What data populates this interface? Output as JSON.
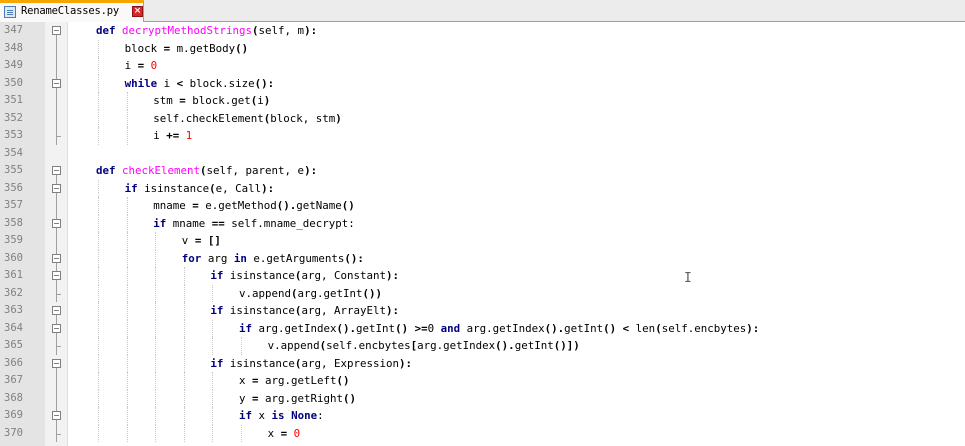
{
  "tab": {
    "title": "RenameClasses.py",
    "icon": "python-file-icon",
    "close_icon": "close-icon"
  },
  "colors": {
    "keyword": "#00007f",
    "function_name": "#ff00ff",
    "number": "#ff0000",
    "tab_accent": "#f7a500"
  },
  "lines": [
    {
      "num": "347",
      "fold": "box",
      "indent": 0,
      "tokens": [
        [
          "kw",
          "def "
        ],
        [
          "fn",
          "decryptMethodStrings"
        ],
        [
          "op",
          "("
        ],
        [
          "t",
          "self, m"
        ],
        [
          "op",
          "):"
        ]
      ]
    },
    {
      "num": "348",
      "fold": "line",
      "indent": 1,
      "tokens": [
        [
          "t",
          "block "
        ],
        [
          "op",
          "="
        ],
        [
          "t",
          " m.getBody"
        ],
        [
          "op",
          "()"
        ]
      ]
    },
    {
      "num": "349",
      "fold": "line",
      "indent": 1,
      "tokens": [
        [
          "t",
          "i "
        ],
        [
          "op",
          "="
        ],
        [
          "t",
          " "
        ],
        [
          "num",
          "0"
        ]
      ]
    },
    {
      "num": "350",
      "fold": "box",
      "indent": 1,
      "tokens": [
        [
          "kw",
          "while"
        ],
        [
          "t",
          " i "
        ],
        [
          "op",
          "<"
        ],
        [
          "t",
          " block.size"
        ],
        [
          "op",
          "():"
        ]
      ]
    },
    {
      "num": "351",
      "fold": "line",
      "indent": 2,
      "tokens": [
        [
          "t",
          "stm "
        ],
        [
          "op",
          "="
        ],
        [
          "t",
          " block.get"
        ],
        [
          "op",
          "("
        ],
        [
          "t",
          "i"
        ],
        [
          "op",
          ")"
        ]
      ]
    },
    {
      "num": "352",
      "fold": "line",
      "indent": 2,
      "tokens": [
        [
          "t",
          "self.checkElement"
        ],
        [
          "op",
          "("
        ],
        [
          "t",
          "block, stm"
        ],
        [
          "op",
          ")"
        ]
      ]
    },
    {
      "num": "353",
      "fold": "end",
      "indent": 2,
      "tokens": [
        [
          "t",
          "i "
        ],
        [
          "op",
          "+="
        ],
        [
          "t",
          " "
        ],
        [
          "num",
          "1"
        ]
      ]
    },
    {
      "num": "354",
      "fold": "none",
      "indent": 0,
      "tokens": []
    },
    {
      "num": "355",
      "fold": "box",
      "indent": 0,
      "tokens": [
        [
          "kw",
          "def "
        ],
        [
          "fn",
          "checkElement"
        ],
        [
          "op",
          "("
        ],
        [
          "t",
          "self, parent, e"
        ],
        [
          "op",
          "):"
        ]
      ]
    },
    {
      "num": "356",
      "fold": "box",
      "indent": 1,
      "tokens": [
        [
          "kw",
          "if"
        ],
        [
          "t",
          " isinstance"
        ],
        [
          "op",
          "("
        ],
        [
          "t",
          "e, Call"
        ],
        [
          "op",
          "):"
        ]
      ]
    },
    {
      "num": "357",
      "fold": "line",
      "indent": 2,
      "tokens": [
        [
          "t",
          "mname "
        ],
        [
          "op",
          "="
        ],
        [
          "t",
          " e.getMethod"
        ],
        [
          "op",
          "()."
        ],
        [
          "t",
          "getName"
        ],
        [
          "op",
          "()"
        ]
      ]
    },
    {
      "num": "358",
      "fold": "box",
      "indent": 2,
      "tokens": [
        [
          "kw",
          "if"
        ],
        [
          "t",
          " mname "
        ],
        [
          "op",
          "=="
        ],
        [
          "t",
          " self.mname_decrypt:"
        ]
      ]
    },
    {
      "num": "359",
      "fold": "line",
      "indent": 3,
      "tokens": [
        [
          "t",
          "v "
        ],
        [
          "op",
          "="
        ],
        [
          "t",
          " "
        ],
        [
          "op",
          "[]"
        ]
      ]
    },
    {
      "num": "360",
      "fold": "box",
      "indent": 3,
      "tokens": [
        [
          "kw",
          "for"
        ],
        [
          "t",
          " arg "
        ],
        [
          "kw",
          "in"
        ],
        [
          "t",
          " e.getArguments"
        ],
        [
          "op",
          "():"
        ]
      ]
    },
    {
      "num": "361",
      "fold": "box",
      "indent": 4,
      "tokens": [
        [
          "kw",
          "if"
        ],
        [
          "t",
          " isinstance"
        ],
        [
          "op",
          "("
        ],
        [
          "t",
          "arg, Constant"
        ],
        [
          "op",
          "):"
        ]
      ]
    },
    {
      "num": "362",
      "fold": "end",
      "indent": 5,
      "tokens": [
        [
          "t",
          "v.append"
        ],
        [
          "op",
          "("
        ],
        [
          "t",
          "arg.getInt"
        ],
        [
          "op",
          "())"
        ]
      ]
    },
    {
      "num": "363",
      "fold": "box",
      "indent": 4,
      "tokens": [
        [
          "kw",
          "if"
        ],
        [
          "t",
          " isinstance"
        ],
        [
          "op",
          "("
        ],
        [
          "t",
          "arg, ArrayElt"
        ],
        [
          "op",
          "):"
        ]
      ]
    },
    {
      "num": "364",
      "fold": "box",
      "indent": 5,
      "tokens": [
        [
          "kw",
          "if"
        ],
        [
          "t",
          " arg.getIndex"
        ],
        [
          "op",
          "()."
        ],
        [
          "t",
          "getInt"
        ],
        [
          "op",
          "() >="
        ],
        [
          "t",
          "0 "
        ],
        [
          "kw",
          "and"
        ],
        [
          "t",
          " arg.getIndex"
        ],
        [
          "op",
          "()."
        ],
        [
          "t",
          "getInt"
        ],
        [
          "op",
          "() <"
        ],
        [
          "t",
          " len"
        ],
        [
          "op",
          "("
        ],
        [
          "t",
          "self.encbytes"
        ],
        [
          "op",
          "):"
        ]
      ]
    },
    {
      "num": "365",
      "fold": "end",
      "indent": 6,
      "tokens": [
        [
          "t",
          "v.append"
        ],
        [
          "op",
          "("
        ],
        [
          "t",
          "self.encbytes"
        ],
        [
          "op",
          "["
        ],
        [
          "t",
          "arg.getIndex"
        ],
        [
          "op",
          "()."
        ],
        [
          "t",
          "getInt"
        ],
        [
          "op",
          "()])"
        ]
      ]
    },
    {
      "num": "366",
      "fold": "box",
      "indent": 4,
      "tokens": [
        [
          "kw",
          "if"
        ],
        [
          "t",
          " isinstance"
        ],
        [
          "op",
          "("
        ],
        [
          "t",
          "arg, Expression"
        ],
        [
          "op",
          "):"
        ]
      ]
    },
    {
      "num": "367",
      "fold": "line",
      "indent": 5,
      "tokens": [
        [
          "t",
          "x "
        ],
        [
          "op",
          "="
        ],
        [
          "t",
          " arg.getLeft"
        ],
        [
          "op",
          "()"
        ]
      ]
    },
    {
      "num": "368",
      "fold": "line",
      "indent": 5,
      "tokens": [
        [
          "t",
          "y "
        ],
        [
          "op",
          "="
        ],
        [
          "t",
          " arg.getRight"
        ],
        [
          "op",
          "()"
        ]
      ]
    },
    {
      "num": "369",
      "fold": "box",
      "indent": 5,
      "tokens": [
        [
          "kw",
          "if"
        ],
        [
          "t",
          " x "
        ],
        [
          "kw",
          "is"
        ],
        [
          "t",
          " "
        ],
        [
          "kw",
          "None"
        ],
        [
          "t",
          ":"
        ]
      ]
    },
    {
      "num": "370",
      "fold": "end",
      "indent": 6,
      "tokens": [
        [
          "t",
          "x "
        ],
        [
          "op",
          "="
        ],
        [
          "t",
          " "
        ],
        [
          "num",
          "0"
        ]
      ]
    }
  ]
}
